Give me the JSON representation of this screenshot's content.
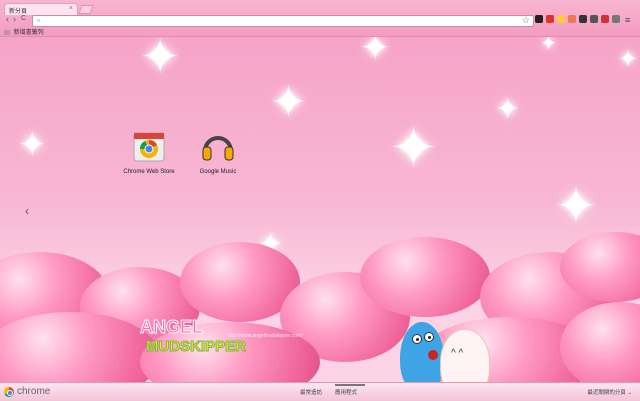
{
  "tab": {
    "title": "新分頁",
    "close": "×"
  },
  "toolbar": {
    "back": "‹",
    "forward": "›",
    "reload": "C",
    "home": "⌂",
    "omnibox_value": "",
    "star": "☆"
  },
  "bookmarks": {
    "folder_label": "新增書籤列"
  },
  "apps": [
    {
      "label": "Chrome Web Store",
      "icon": "chrome-web-store-icon"
    },
    {
      "label": "Google Music",
      "icon": "headphones-icon"
    }
  ],
  "theme": {
    "logo_line1": "ANGEL",
    "logo_line2": "MUDSKIPPER",
    "url": "http://www.angelmudskipper.com/"
  },
  "bottom": {
    "brand": "chrome",
    "tabs": [
      "最常造訪",
      "應用程式"
    ],
    "selected_tab": "應用程式",
    "recent": "最近關閉的分頁"
  },
  "colors": {
    "accent": "#f39cc1",
    "heart": "#f0669d"
  }
}
